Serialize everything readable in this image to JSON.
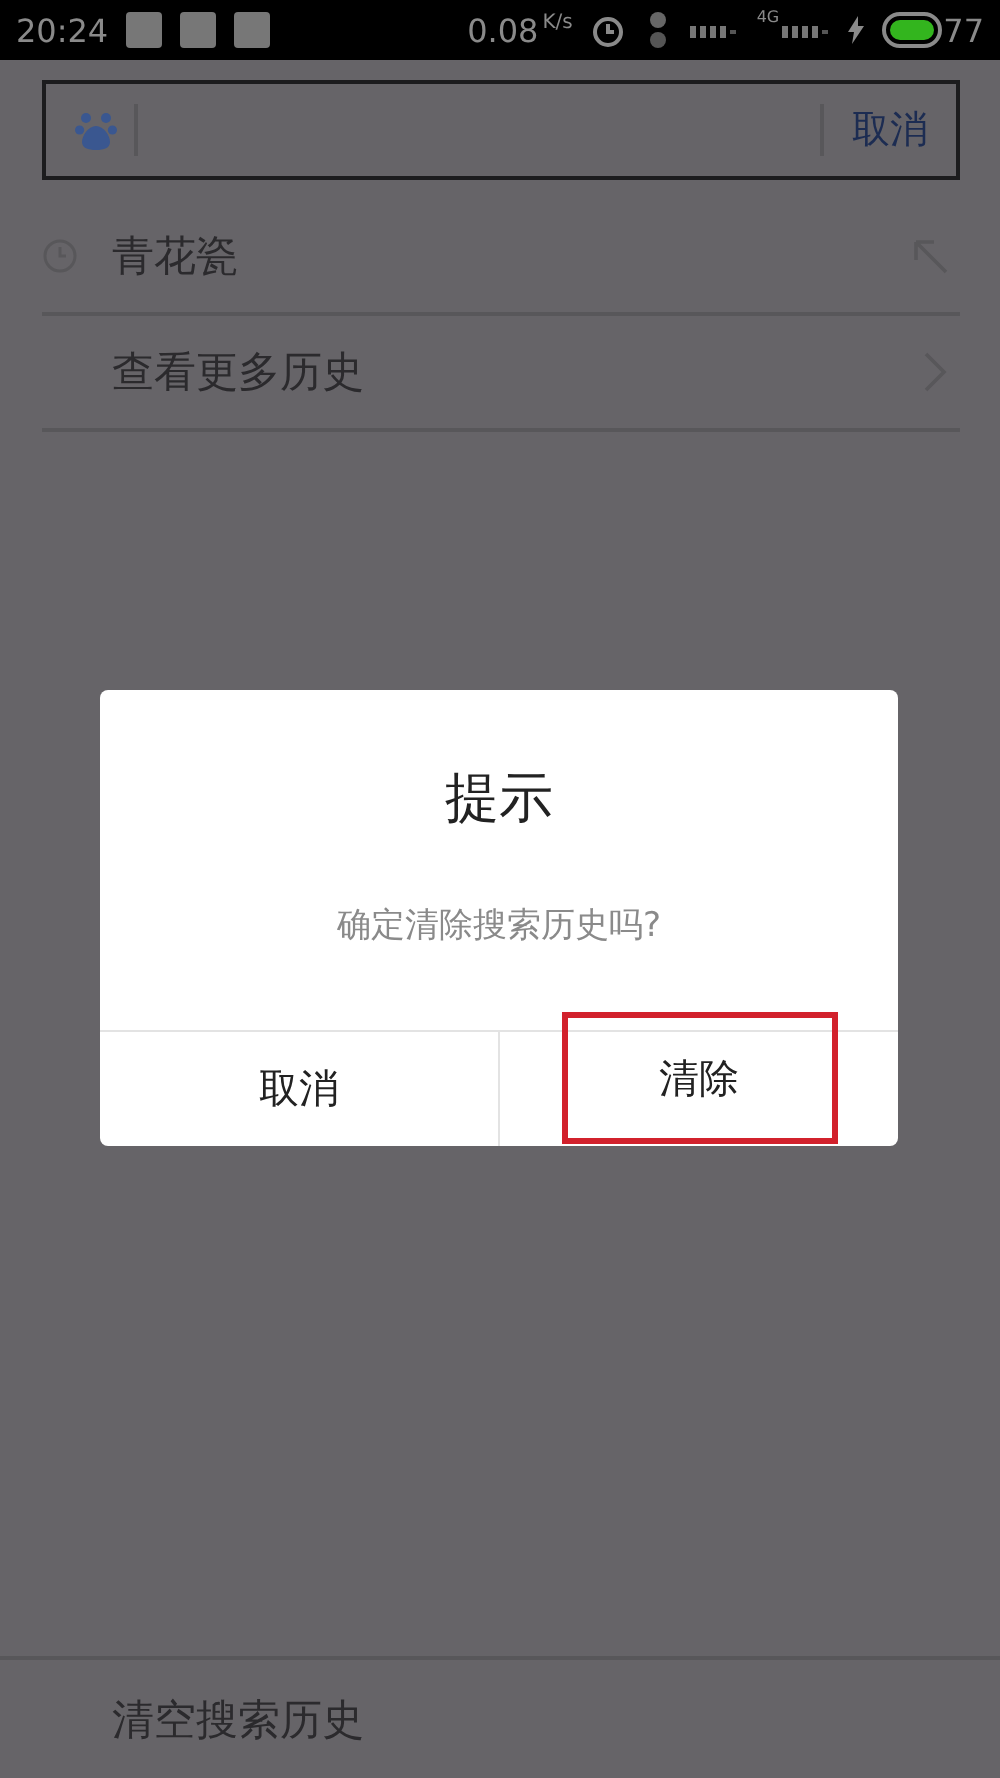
{
  "status_bar": {
    "time": "20:24",
    "speed": "0.08",
    "speed_unit": "K/s",
    "network": "4G",
    "battery": "77"
  },
  "search": {
    "cancel": "取消"
  },
  "history": [
    {
      "label": "青花瓷",
      "kind": "entry"
    },
    {
      "label": "查看更多历史",
      "kind": "more"
    }
  ],
  "clear_history": "清空搜索历史",
  "dialog": {
    "title": "提示",
    "message": "确定清除搜索历史吗?",
    "buttons": [
      {
        "label": "取消",
        "highlighted": false
      },
      {
        "label": "清除",
        "highlighted": true
      }
    ]
  }
}
